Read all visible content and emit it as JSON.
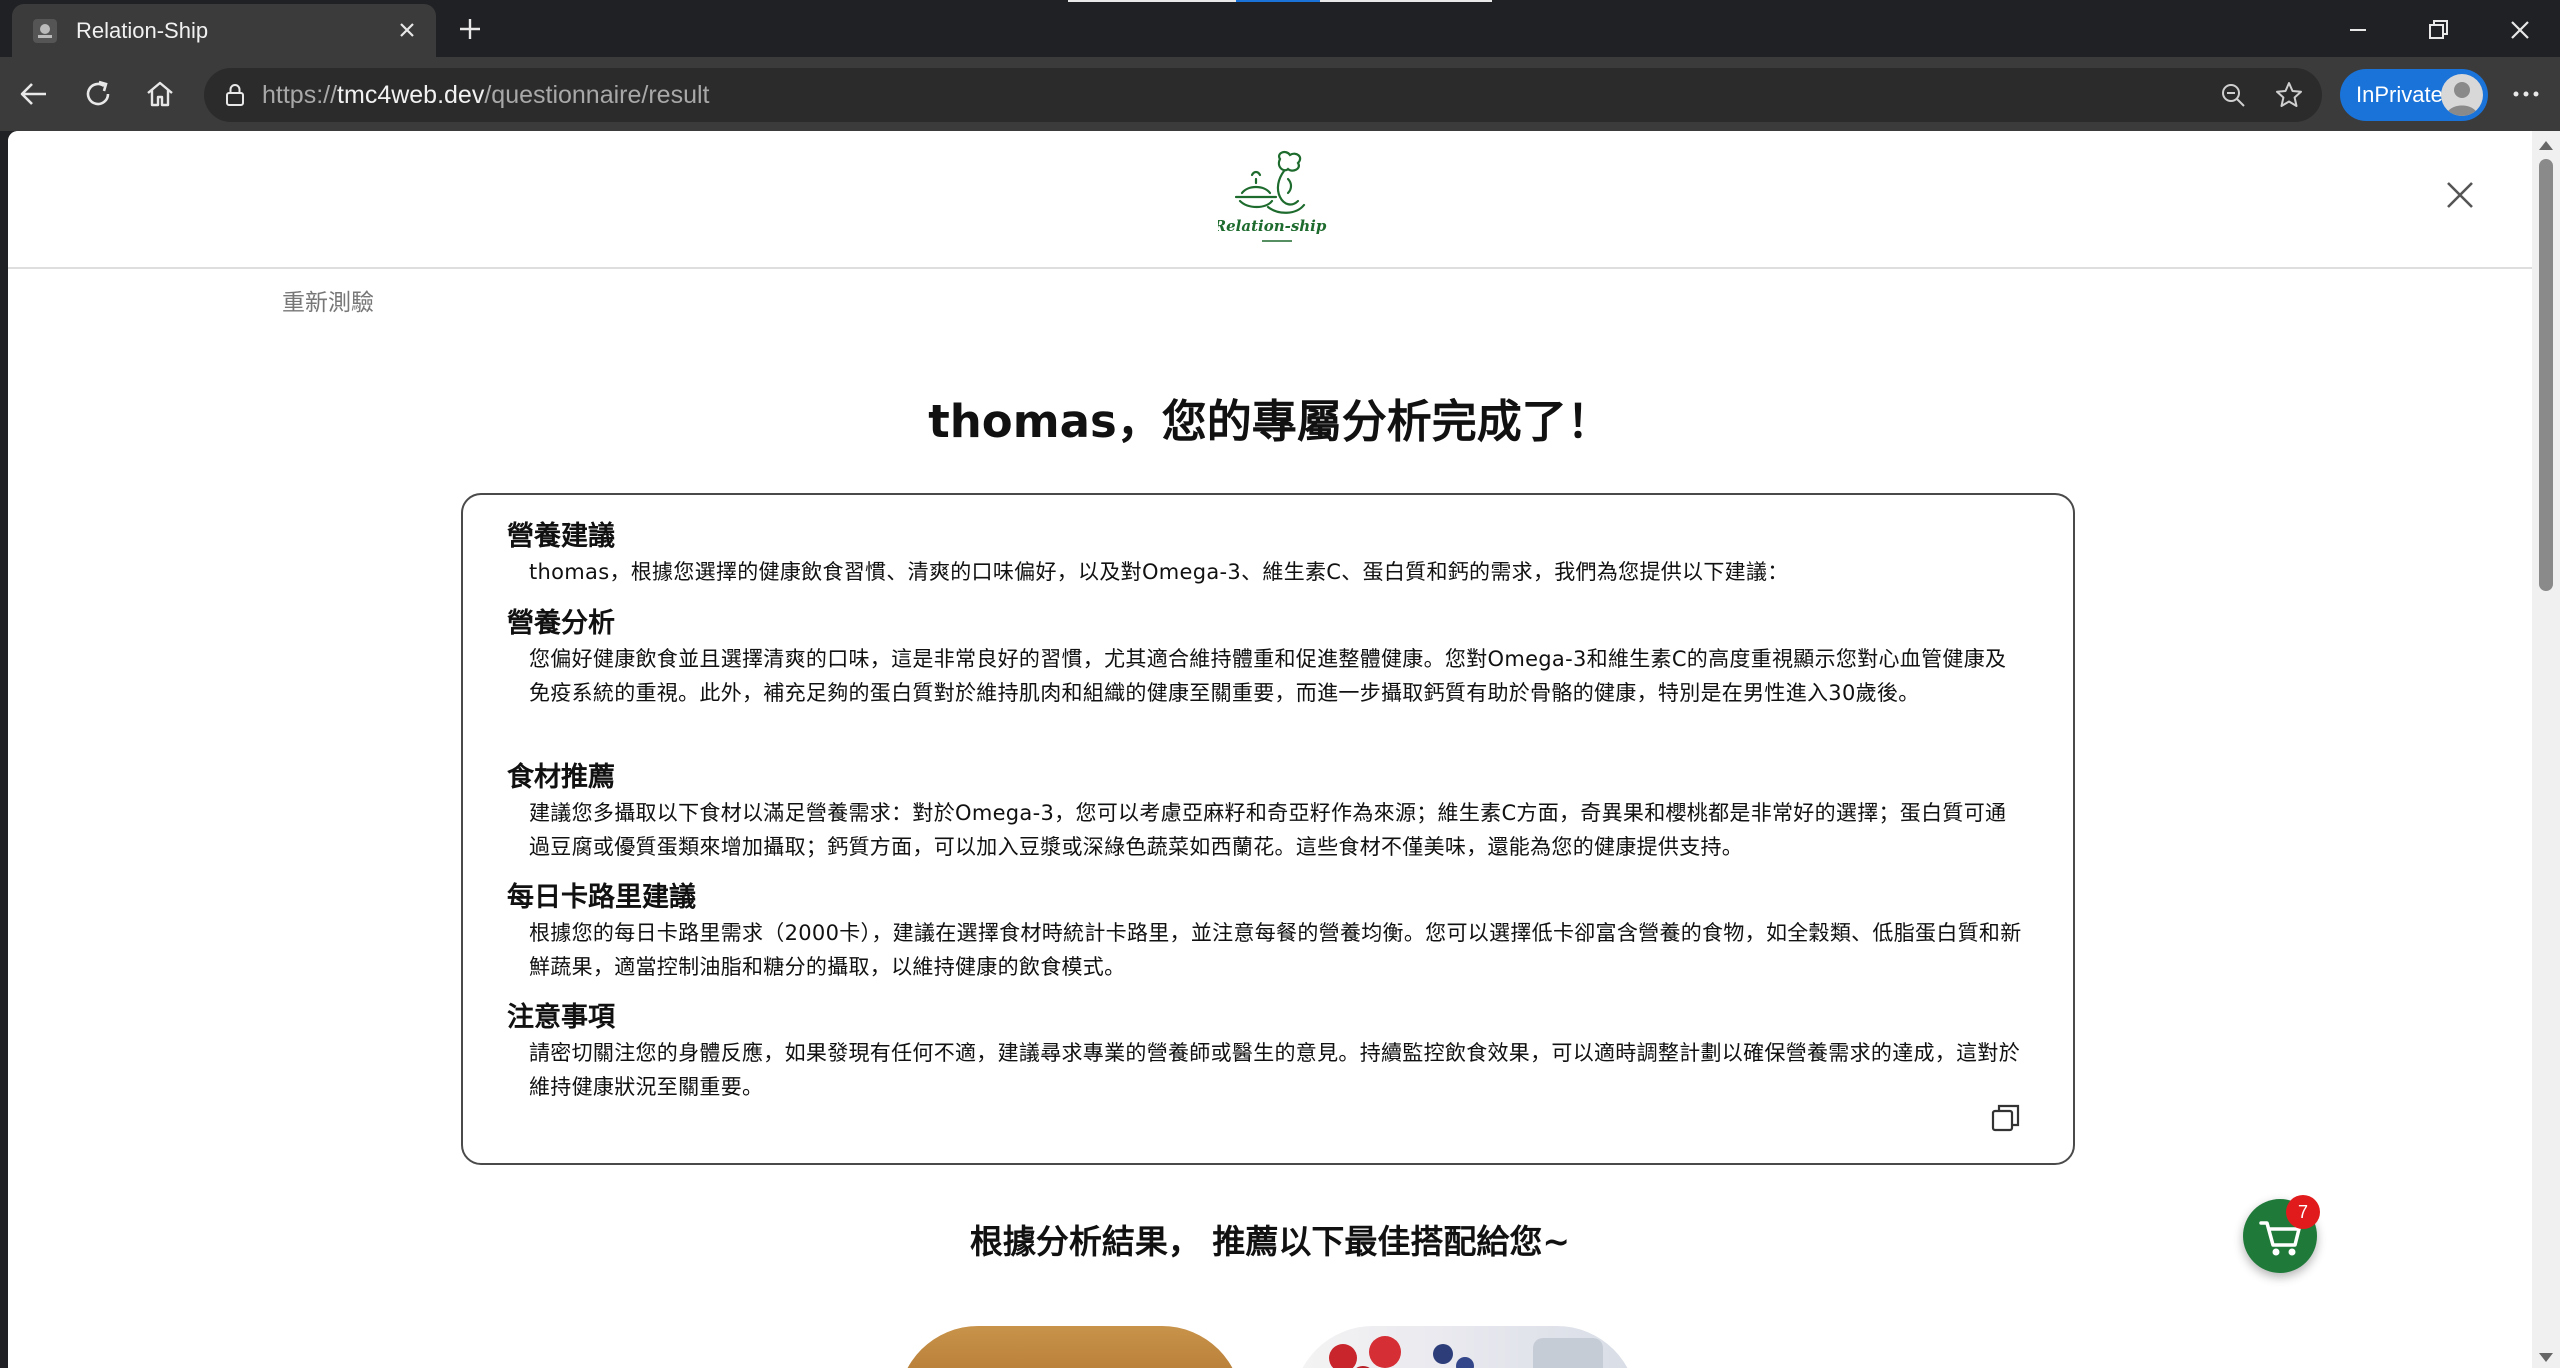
{
  "browser": {
    "tab_title": "Relation-Ship",
    "url_prefix": "https://",
    "url_host": "tmc4web.dev",
    "url_path": "/questionnaire/result",
    "inprivate_label": "InPrivate",
    "icons": [
      "back-icon",
      "refresh-icon",
      "home-icon",
      "lock-icon",
      "zoom-icon",
      "favorite-star-icon",
      "more-icon"
    ]
  },
  "page": {
    "logo_text": "Relation-ship",
    "retest_link": "重新測驗",
    "result_title": "thomas，您的專屬分析完成了！",
    "analysis": {
      "sections": [
        {
          "heading": "營養建議",
          "body": "thomas，根據您選擇的健康飲食習慣、清爽的口味偏好，以及對Omega-3、維生素C、蛋白質和鈣的需求，我們為您提供以下建議："
        },
        {
          "heading": "營養分析",
          "body": "您偏好健康飲食並且選擇清爽的口味，這是非常良好的習慣，尤其適合維持體重和促進整體健康。您對Omega-3和維生素C的高度重視顯示您對心血管健康及免疫系統的重視。此外，補充足夠的蛋白質對於維持肌肉和組織的健康至關重要，而進一步攝取鈣質有助於骨骼的健康，特別是在男性進入30歲後。"
        },
        {
          "heading": "食材推薦",
          "body": "建議您多攝取以下食材以滿足營養需求：對於Omega-3，您可以考慮亞麻籽和奇亞籽作為來源；維生素C方面，奇異果和櫻桃都是非常好的選擇；蛋白質可通過豆腐或優質蛋類來增加攝取；鈣質方面，可以加入豆漿或深綠色蔬菜如西蘭花。這些食材不僅美味，還能為您的健康提供支持。"
        },
        {
          "heading": "每日卡路里建議",
          "body": "根據您的每日卡路里需求（2000卡），建議在選擇食材時統計卡路里，並注意每餐的營養均衡。您可以選擇低卡卻富含營養的食物，如全穀類、低脂蛋白質和新鮮蔬果，適當控制油脂和糖分的攝取，以維持健康的飲食模式。"
        },
        {
          "heading": "注意事項",
          "body": "請密切關注您的身體反應，如果發現有任何不適，建議尋求專業的營養師或醫生的意見。持續監控飲食效果，可以適時調整計劃以確保營養需求的達成，這對於維持健康狀況至關重要。"
        }
      ]
    },
    "recommend_title": "根據分析結果， 推薦以下最佳搭配給您~",
    "cart_count": "7"
  },
  "colors": {
    "brand_green": "#1f7a3a",
    "badge_red": "#e11b1b",
    "inprivate_blue": "#1a73d9"
  }
}
